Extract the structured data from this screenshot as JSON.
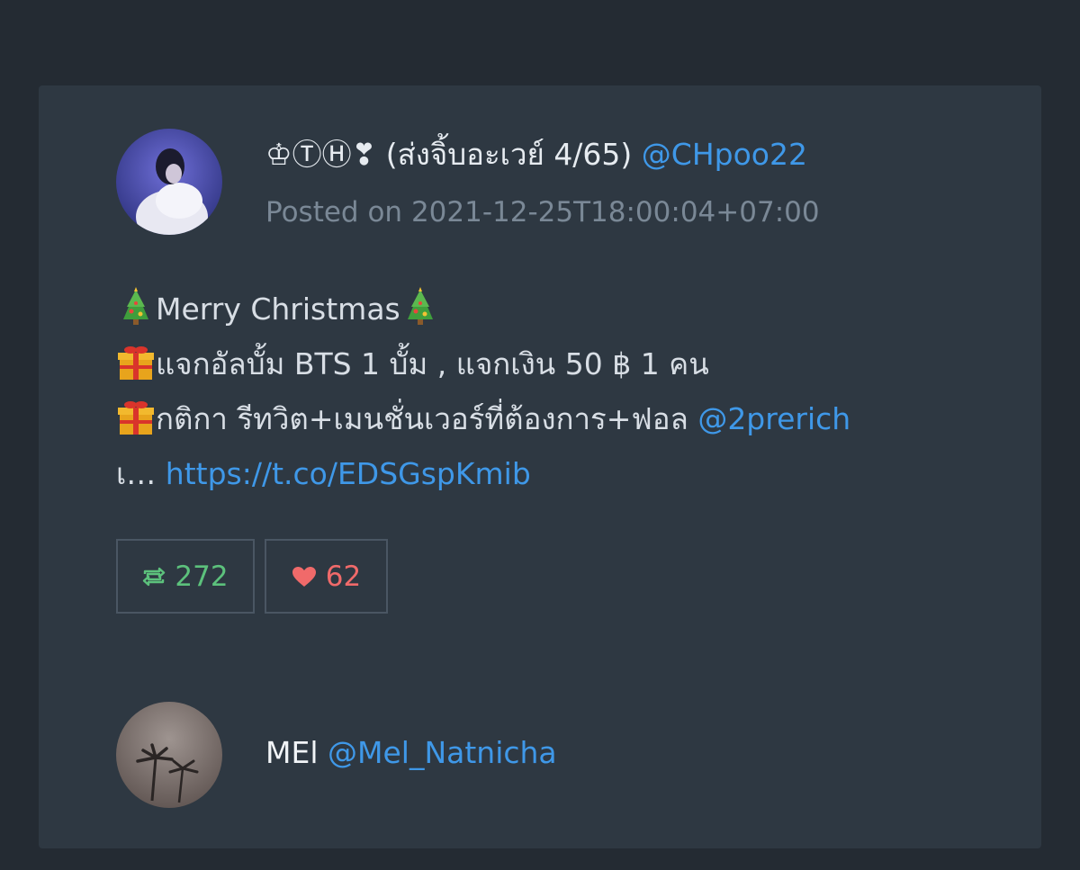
{
  "tweet": {
    "display_name": "♔ⓉⒽ❣ (ส่งจิ้บอะเวย์ 4/65)",
    "handle": "@CHpoo22",
    "posted_label": "Posted on",
    "posted_at": "2021-12-25T18:00:04+07:00",
    "line1_text": "Merry Christmas",
    "line2_text": "แจกอัลบั้ม BTS 1 บั้ม , แจกเงิน 50 ฿ 1 คน",
    "line3_text": "กติกา รีทวิต+เมนชั่นเวอร์ที่ต้องการ+ฟอล",
    "line3_mention": "@2prerich",
    "line4_prefix": "เ…",
    "line4_link": "https://t.co/EDSGspKmib",
    "retweets": "272",
    "likes": "62"
  },
  "reply": {
    "display_name": "MEl",
    "handle": "@Mel_Natnicha"
  },
  "icons": {
    "christmas_tree": "christmas-tree-icon",
    "gift": "gift-icon",
    "retweet": "retweet-icon",
    "heart": "heart-icon"
  },
  "colors": {
    "page_bg": "#242b33",
    "card_bg": "#2e3842",
    "link": "#3f98e8",
    "retweet": "#5cc17c",
    "like": "#f06a6a"
  }
}
